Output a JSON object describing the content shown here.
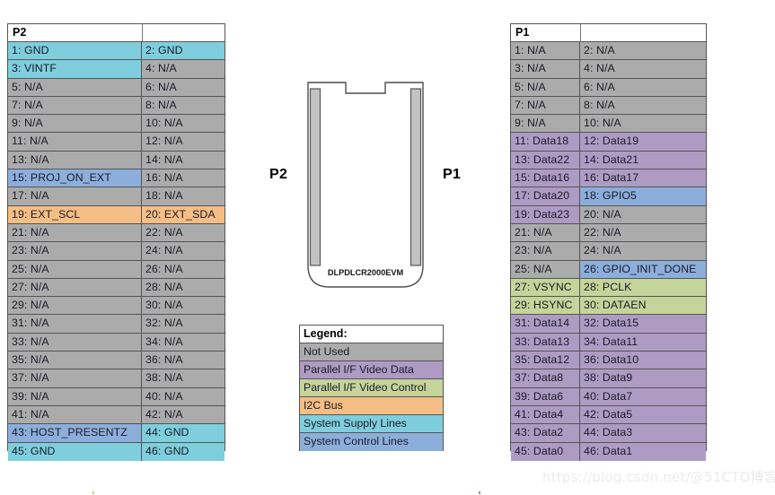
{
  "page": {
    "watermark": "https://blog.csdn.net/@51CTO博客"
  },
  "board": {
    "silkscreen_label": "DLPDLCR2000EVM",
    "left_connector_label": "P2",
    "right_connector_label": "P1"
  },
  "legend": {
    "title": "Legend:",
    "items": [
      {
        "label": "Not Used",
        "color": "#ababab",
        "class": "c-gray"
      },
      {
        "label": "Parallel I/F Video Data",
        "color": "#ae9bc4",
        "class": "c-purple"
      },
      {
        "label": "Parallel I/F Video Control",
        "color": "#c5d49a",
        "class": "c-green"
      },
      {
        "label": "I2C Bus",
        "color": "#f5be84",
        "class": "c-orange"
      },
      {
        "label": "System Supply Lines",
        "color": "#7fcedd",
        "class": "c-cyan"
      },
      {
        "label": "System Control Lines",
        "color": "#8caedb",
        "class": "c-blue"
      }
    ]
  },
  "p2": {
    "title": "P2",
    "rows": [
      {
        "left": "1: GND",
        "left_class": "c-cyan",
        "right": "2: GND",
        "right_class": "c-cyan"
      },
      {
        "left": "3: VINTF",
        "left_class": "c-cyan",
        "right": "4: N/A",
        "right_class": "c-gray"
      },
      {
        "left": "5: N/A",
        "left_class": "c-gray",
        "right": "6: N/A",
        "right_class": "c-gray"
      },
      {
        "left": "7: N/A",
        "left_class": "c-gray",
        "right": "8: N/A",
        "right_class": "c-gray"
      },
      {
        "left": "9: N/A",
        "left_class": "c-gray",
        "right": "10: N/A",
        "right_class": "c-gray"
      },
      {
        "left": "11: N/A",
        "left_class": "c-gray",
        "right": "12: N/A",
        "right_class": "c-gray"
      },
      {
        "left": "13: N/A",
        "left_class": "c-gray",
        "right": "14: N/A",
        "right_class": "c-gray"
      },
      {
        "left": "15: PROJ_ON_EXT",
        "left_class": "c-blue",
        "right": "16: N/A",
        "right_class": "c-gray"
      },
      {
        "left": "17: N/A",
        "left_class": "c-gray",
        "right": "18: N/A",
        "right_class": "c-gray"
      },
      {
        "left": "19: EXT_SCL",
        "left_class": "c-orange",
        "right": "20: EXT_SDA",
        "right_class": "c-orange"
      },
      {
        "left": "21: N/A",
        "left_class": "c-gray",
        "right": "22: N/A",
        "right_class": "c-gray"
      },
      {
        "left": "23: N/A",
        "left_class": "c-gray",
        "right": "24: N/A",
        "right_class": "c-gray"
      },
      {
        "left": "25: N/A",
        "left_class": "c-gray",
        "right": "26: N/A",
        "right_class": "c-gray"
      },
      {
        "left": "27: N/A",
        "left_class": "c-gray",
        "right": "28: N/A",
        "right_class": "c-gray"
      },
      {
        "left": "29: N/A",
        "left_class": "c-gray",
        "right": "30: N/A",
        "right_class": "c-gray"
      },
      {
        "left": "31: N/A",
        "left_class": "c-gray",
        "right": "32: N/A",
        "right_class": "c-gray"
      },
      {
        "left": "33: N/A",
        "left_class": "c-gray",
        "right": "34: N/A",
        "right_class": "c-gray"
      },
      {
        "left": "35: N/A",
        "left_class": "c-gray",
        "right": "36: N/A",
        "right_class": "c-gray"
      },
      {
        "left": "37: N/A",
        "left_class": "c-gray",
        "right": "38: N/A",
        "right_class": "c-gray"
      },
      {
        "left": "39: N/A",
        "left_class": "c-gray",
        "right": "40: N/A",
        "right_class": "c-gray"
      },
      {
        "left": "41: N/A",
        "left_class": "c-gray",
        "right": "42: N/A",
        "right_class": "c-gray"
      },
      {
        "left": "43: HOST_PRESENTZ",
        "left_class": "c-blue",
        "right": "44: GND",
        "right_class": "c-cyan"
      },
      {
        "left": "45: GND",
        "left_class": "c-cyan",
        "right": "46: GND",
        "right_class": "c-cyan"
      }
    ]
  },
  "p1": {
    "title": "P1",
    "rows": [
      {
        "left": "1: N/A",
        "left_class": "c-gray",
        "right": "2: N/A",
        "right_class": "c-gray"
      },
      {
        "left": "3: N/A",
        "left_class": "c-gray",
        "right": "4: N/A",
        "right_class": "c-gray"
      },
      {
        "left": "5: N/A",
        "left_class": "c-gray",
        "right": "6: N/A",
        "right_class": "c-gray"
      },
      {
        "left": "7: N/A",
        "left_class": "c-gray",
        "right": "8: N/A",
        "right_class": "c-gray"
      },
      {
        "left": "9: N/A",
        "left_class": "c-gray",
        "right": "10: N/A",
        "right_class": "c-gray"
      },
      {
        "left": "11: Data18",
        "left_class": "c-purple",
        "right": "12: Data19",
        "right_class": "c-purple"
      },
      {
        "left": "13: Data22",
        "left_class": "c-purple",
        "right": "14: Data21",
        "right_class": "c-purple"
      },
      {
        "left": "15: Data16",
        "left_class": "c-purple",
        "right": "16: Data17",
        "right_class": "c-purple"
      },
      {
        "left": "17: Data20",
        "left_class": "c-purple",
        "right": "18: GPIO5",
        "right_class": "c-blue"
      },
      {
        "left": "19: Data23",
        "left_class": "c-purple",
        "right": "20: N/A",
        "right_class": "c-gray"
      },
      {
        "left": "21: N/A",
        "left_class": "c-gray",
        "right": "22: N/A",
        "right_class": "c-gray"
      },
      {
        "left": "23: N/A",
        "left_class": "c-gray",
        "right": "24: N/A",
        "right_class": "c-gray"
      },
      {
        "left": "25: N/A",
        "left_class": "c-gray",
        "right": "26: GPIO_INIT_DONE",
        "right_class": "c-blue"
      },
      {
        "left": "27: VSYNC",
        "left_class": "c-green",
        "right": "28: PCLK",
        "right_class": "c-green"
      },
      {
        "left": "29: HSYNC",
        "left_class": "c-green",
        "right": "30: DATAEN",
        "right_class": "c-green"
      },
      {
        "left": "31: Data14",
        "left_class": "c-purple",
        "right": "32: Data15",
        "right_class": "c-purple"
      },
      {
        "left": "33: Data13",
        "left_class": "c-purple",
        "right": "34: Data11",
        "right_class": "c-purple"
      },
      {
        "left": "35: Data12",
        "left_class": "c-purple",
        "right": "36: Data10",
        "right_class": "c-purple"
      },
      {
        "left": "37: Data8",
        "left_class": "c-purple",
        "right": "38: Data9",
        "right_class": "c-purple"
      },
      {
        "left": "39: Data6",
        "left_class": "c-purple",
        "right": "40: Data7",
        "right_class": "c-purple"
      },
      {
        "left": "41: Data4",
        "left_class": "c-purple",
        "right": "42: Data5",
        "right_class": "c-purple"
      },
      {
        "left": "43: Data2",
        "left_class": "c-purple",
        "right": "44: Data3",
        "right_class": "c-purple"
      },
      {
        "left": "45: Data0",
        "left_class": "c-purple",
        "right": "46: Data1",
        "right_class": "c-purple"
      }
    ]
  }
}
